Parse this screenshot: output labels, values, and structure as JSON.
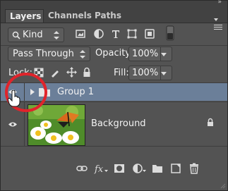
{
  "tabs": [
    {
      "label": "Layers",
      "active": true
    },
    {
      "label": "Channels",
      "active": false
    },
    {
      "label": "Paths",
      "active": false
    }
  ],
  "filter": {
    "kind_label": "Kind"
  },
  "blend": {
    "mode": "Pass Through",
    "opacity_label": "Opacity:",
    "opacity_value": "100%"
  },
  "lock": {
    "label": "Lock:",
    "fill_label": "Fill:",
    "fill_value": "100%"
  },
  "layers": [
    {
      "name": "Group 1",
      "type": "group",
      "selected": true,
      "visible": true
    },
    {
      "name": "Background",
      "type": "image",
      "selected": false,
      "visible": true,
      "locked": true
    }
  ],
  "colors": {
    "selection": "#6b7f99",
    "panel": "#535353",
    "highlight_circle": "#e0242b"
  },
  "icons": [
    "link-icon",
    "fx-icon",
    "mask-icon",
    "adjustment-icon",
    "new-group-icon",
    "new-layer-icon",
    "trash-icon"
  ]
}
